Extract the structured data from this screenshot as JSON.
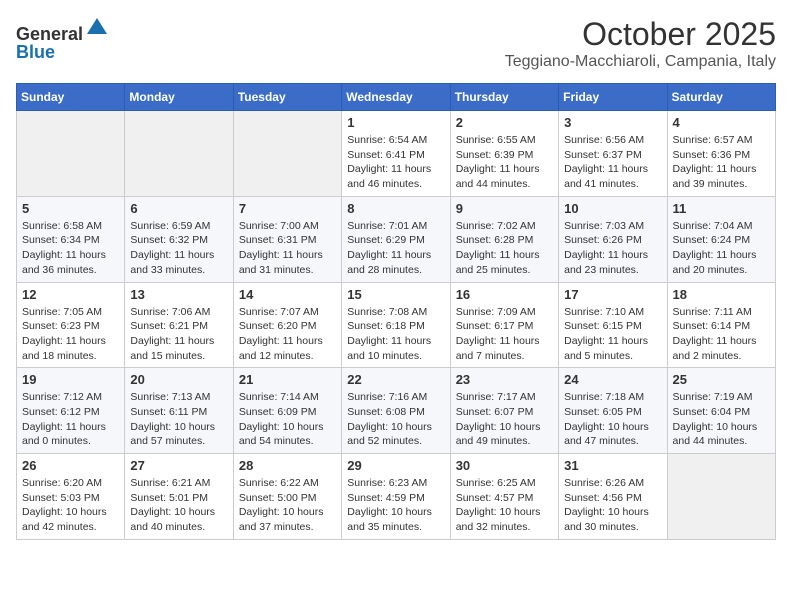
{
  "header": {
    "logo_line1": "General",
    "logo_line2": "Blue",
    "month": "October 2025",
    "location": "Teggiano-Macchiaroli, Campania, Italy"
  },
  "weekdays": [
    "Sunday",
    "Monday",
    "Tuesday",
    "Wednesday",
    "Thursday",
    "Friday",
    "Saturday"
  ],
  "weeks": [
    [
      {
        "day": null
      },
      {
        "day": null
      },
      {
        "day": null
      },
      {
        "day": "1",
        "sunrise": "6:54 AM",
        "sunset": "6:41 PM",
        "daylight": "11 hours and 46 minutes."
      },
      {
        "day": "2",
        "sunrise": "6:55 AM",
        "sunset": "6:39 PM",
        "daylight": "11 hours and 44 minutes."
      },
      {
        "day": "3",
        "sunrise": "6:56 AM",
        "sunset": "6:37 PM",
        "daylight": "11 hours and 41 minutes."
      },
      {
        "day": "4",
        "sunrise": "6:57 AM",
        "sunset": "6:36 PM",
        "daylight": "11 hours and 39 minutes."
      }
    ],
    [
      {
        "day": "5",
        "sunrise": "6:58 AM",
        "sunset": "6:34 PM",
        "daylight": "11 hours and 36 minutes."
      },
      {
        "day": "6",
        "sunrise": "6:59 AM",
        "sunset": "6:32 PM",
        "daylight": "11 hours and 33 minutes."
      },
      {
        "day": "7",
        "sunrise": "7:00 AM",
        "sunset": "6:31 PM",
        "daylight": "11 hours and 31 minutes."
      },
      {
        "day": "8",
        "sunrise": "7:01 AM",
        "sunset": "6:29 PM",
        "daylight": "11 hours and 28 minutes."
      },
      {
        "day": "9",
        "sunrise": "7:02 AM",
        "sunset": "6:28 PM",
        "daylight": "11 hours and 25 minutes."
      },
      {
        "day": "10",
        "sunrise": "7:03 AM",
        "sunset": "6:26 PM",
        "daylight": "11 hours and 23 minutes."
      },
      {
        "day": "11",
        "sunrise": "7:04 AM",
        "sunset": "6:24 PM",
        "daylight": "11 hours and 20 minutes."
      }
    ],
    [
      {
        "day": "12",
        "sunrise": "7:05 AM",
        "sunset": "6:23 PM",
        "daylight": "11 hours and 18 minutes."
      },
      {
        "day": "13",
        "sunrise": "7:06 AM",
        "sunset": "6:21 PM",
        "daylight": "11 hours and 15 minutes."
      },
      {
        "day": "14",
        "sunrise": "7:07 AM",
        "sunset": "6:20 PM",
        "daylight": "11 hours and 12 minutes."
      },
      {
        "day": "15",
        "sunrise": "7:08 AM",
        "sunset": "6:18 PM",
        "daylight": "11 hours and 10 minutes."
      },
      {
        "day": "16",
        "sunrise": "7:09 AM",
        "sunset": "6:17 PM",
        "daylight": "11 hours and 7 minutes."
      },
      {
        "day": "17",
        "sunrise": "7:10 AM",
        "sunset": "6:15 PM",
        "daylight": "11 hours and 5 minutes."
      },
      {
        "day": "18",
        "sunrise": "7:11 AM",
        "sunset": "6:14 PM",
        "daylight": "11 hours and 2 minutes."
      }
    ],
    [
      {
        "day": "19",
        "sunrise": "7:12 AM",
        "sunset": "6:12 PM",
        "daylight": "11 hours and 0 minutes."
      },
      {
        "day": "20",
        "sunrise": "7:13 AM",
        "sunset": "6:11 PM",
        "daylight": "10 hours and 57 minutes."
      },
      {
        "day": "21",
        "sunrise": "7:14 AM",
        "sunset": "6:09 PM",
        "daylight": "10 hours and 54 minutes."
      },
      {
        "day": "22",
        "sunrise": "7:16 AM",
        "sunset": "6:08 PM",
        "daylight": "10 hours and 52 minutes."
      },
      {
        "day": "23",
        "sunrise": "7:17 AM",
        "sunset": "6:07 PM",
        "daylight": "10 hours and 49 minutes."
      },
      {
        "day": "24",
        "sunrise": "7:18 AM",
        "sunset": "6:05 PM",
        "daylight": "10 hours and 47 minutes."
      },
      {
        "day": "25",
        "sunrise": "7:19 AM",
        "sunset": "6:04 PM",
        "daylight": "10 hours and 44 minutes."
      }
    ],
    [
      {
        "day": "26",
        "sunrise": "6:20 AM",
        "sunset": "5:03 PM",
        "daylight": "10 hours and 42 minutes."
      },
      {
        "day": "27",
        "sunrise": "6:21 AM",
        "sunset": "5:01 PM",
        "daylight": "10 hours and 40 minutes."
      },
      {
        "day": "28",
        "sunrise": "6:22 AM",
        "sunset": "5:00 PM",
        "daylight": "10 hours and 37 minutes."
      },
      {
        "day": "29",
        "sunrise": "6:23 AM",
        "sunset": "4:59 PM",
        "daylight": "10 hours and 35 minutes."
      },
      {
        "day": "30",
        "sunrise": "6:25 AM",
        "sunset": "4:57 PM",
        "daylight": "10 hours and 32 minutes."
      },
      {
        "day": "31",
        "sunrise": "6:26 AM",
        "sunset": "4:56 PM",
        "daylight": "10 hours and 30 minutes."
      },
      {
        "day": null
      }
    ]
  ]
}
